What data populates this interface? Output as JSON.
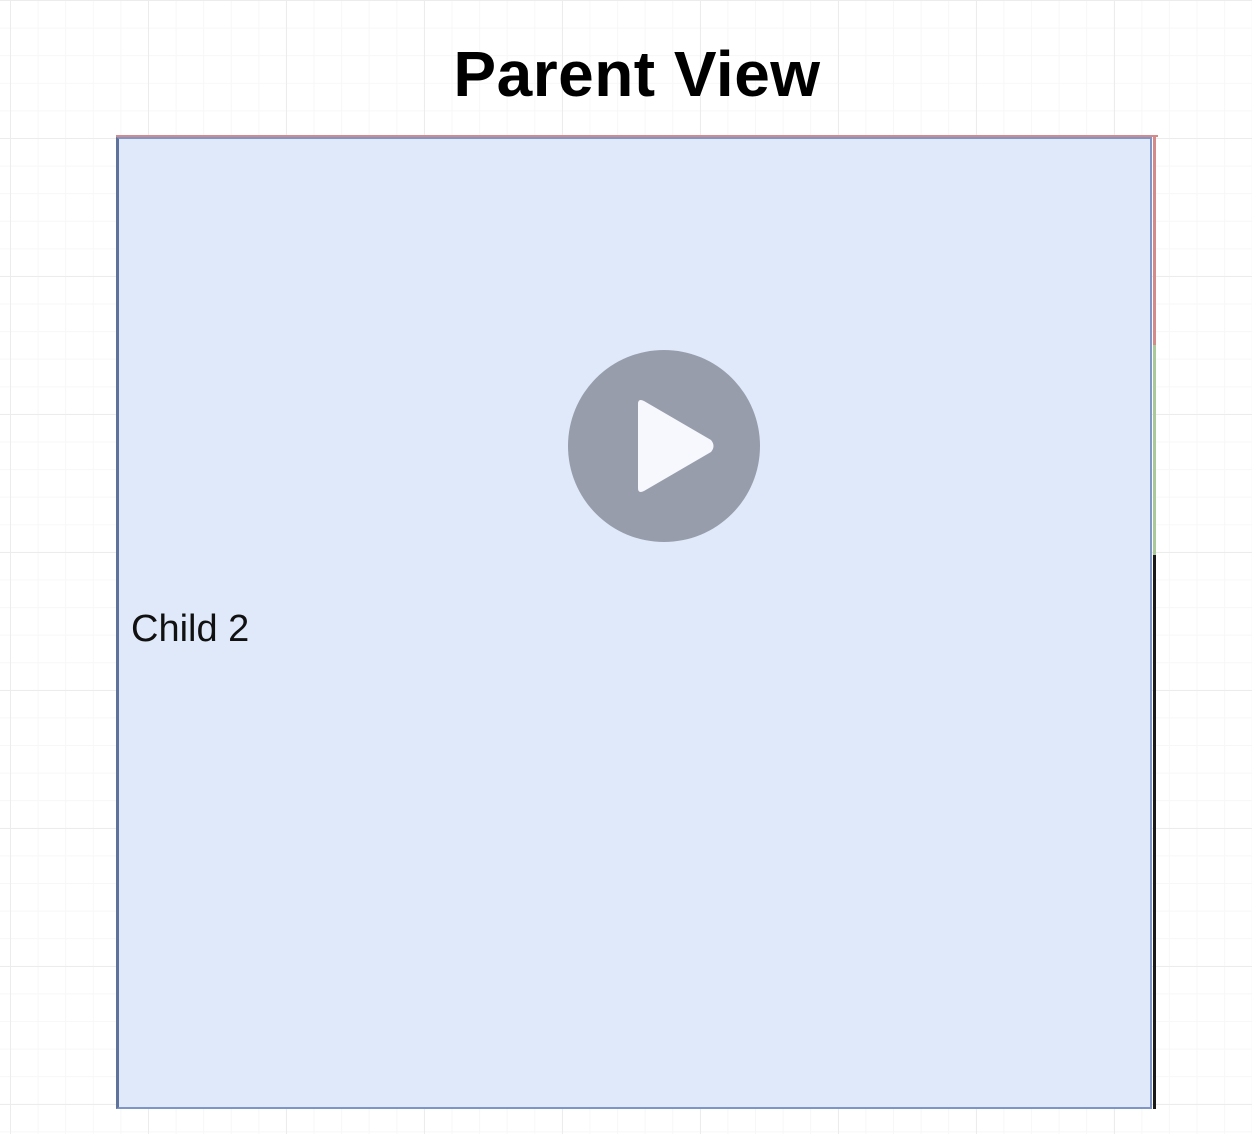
{
  "diagram": {
    "title": "Parent View",
    "child_label": "Child 2"
  },
  "video_overlay": {
    "icon": "play-icon"
  },
  "colors": {
    "child_fill": "#dfe9fa",
    "child_border": "#7f95c6",
    "play_button": "#979daa",
    "edge_red": "#d48a8a",
    "edge_green": "#a9c99a"
  }
}
